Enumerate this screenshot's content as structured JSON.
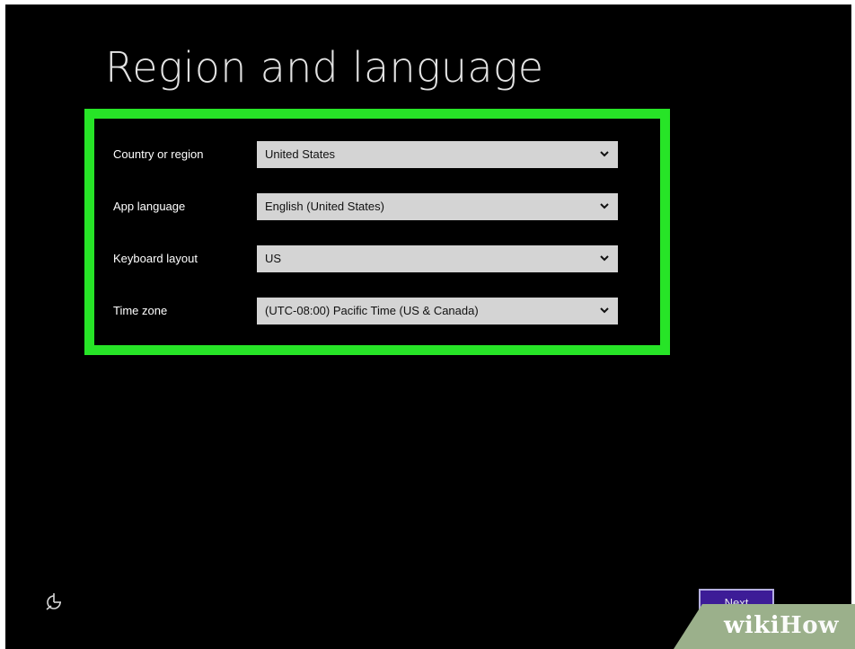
{
  "page": {
    "title": "Region and language"
  },
  "form": {
    "fields": [
      {
        "label": "Country or region",
        "value": "United States"
      },
      {
        "label": "App language",
        "value": "English (United States)"
      },
      {
        "label": "Keyboard layout",
        "value": "US"
      },
      {
        "label": "Time zone",
        "value": "(UTC-08:00) Pacific Time (US & Canada)"
      }
    ]
  },
  "footer": {
    "ease_of_access_icon": "ease-of-access-icon",
    "next_label": "Next"
  },
  "watermark": {
    "wiki": "wiki",
    "how": "How"
  },
  "colors": {
    "background": "#000000",
    "highlight": "#27e427",
    "select_bg": "#d4d4d4",
    "next_button": "#3d1c97"
  }
}
